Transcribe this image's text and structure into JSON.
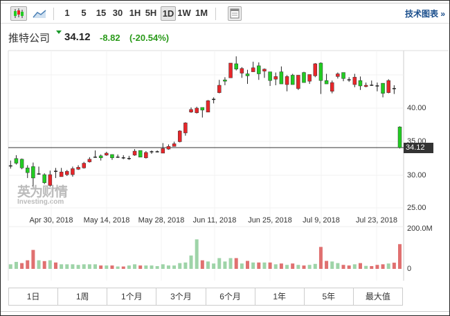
{
  "toolbar": {
    "intervals": [
      "1",
      "5",
      "15",
      "30",
      "1H",
      "5H",
      "1D",
      "1W",
      "1M"
    ],
    "active_interval": "1D",
    "tech_chart_link": "技术图表 »"
  },
  "quote": {
    "name": "推特公司",
    "price": "34.12",
    "change": "-8.82",
    "change_pct": "(-20.54%)",
    "direction": "down"
  },
  "watermark": {
    "cn": "英为财情",
    "en": "Investing.com"
  },
  "axis": {
    "price_labels": [
      "40.00",
      "35.00",
      "30.00",
      "25.00"
    ],
    "volume_labels": [
      "200.0M",
      "0"
    ],
    "dates": [
      "Apr 30, 2018",
      "May 14, 2018",
      "May 28, 2018",
      "Jun 11, 2018",
      "Jun 25, 2018",
      "Jul 9, 2018",
      "Jul 23, 2018"
    ],
    "current_price_tag": "34.12"
  },
  "colors": {
    "candle_up": "#e8262a",
    "candle_down": "#22cc22",
    "vol_red": "#e07070",
    "vol_green": "#9ed4a8"
  },
  "ranges": [
    "1日",
    "1周",
    "1个月",
    "3个月",
    "6个月",
    "1年",
    "5年",
    "最大值"
  ],
  "chart_data": {
    "type": "candlestick",
    "ylim": [
      24,
      49
    ],
    "candles_ohlc": [
      [
        31.4,
        32.2,
        31.0,
        31.4
      ],
      [
        32.5,
        33.0,
        31.6,
        31.8
      ],
      [
        32.4,
        32.5,
        30.9,
        31.1
      ],
      [
        31.1,
        31.5,
        29.6,
        30.4
      ],
      [
        31.3,
        31.9,
        28.4,
        29.6
      ],
      [
        30.2,
        31.3,
        30.1,
        30.2
      ],
      [
        30.1,
        30.3,
        28.7,
        28.9
      ],
      [
        28.5,
        30.7,
        28.3,
        30.1
      ],
      [
        30.6,
        31.1,
        29.6,
        30.6
      ],
      [
        29.8,
        31.1,
        29.8,
        30.5
      ],
      [
        30.1,
        30.8,
        29.9,
        30.6
      ],
      [
        30.1,
        31.3,
        29.8,
        31.0
      ],
      [
        30.9,
        31.5,
        30.8,
        31.2
      ],
      [
        31.1,
        32.0,
        31.0,
        31.8
      ],
      [
        32.0,
        32.7,
        31.9,
        32.4
      ],
      [
        32.7,
        33.7,
        32.6,
        32.7
      ],
      [
        32.9,
        33.1,
        32.2,
        32.6
      ],
      [
        33.0,
        33.5,
        32.9,
        33.3
      ],
      [
        33.1,
        33.1,
        32.3,
        32.6
      ],
      [
        32.7,
        33.1,
        32.6,
        32.7
      ],
      [
        32.6,
        33.0,
        32.4,
        32.6
      ],
      [
        32.5,
        32.9,
        32.3,
        32.5
      ],
      [
        33.0,
        33.9,
        32.9,
        33.6
      ],
      [
        33.7,
        33.7,
        32.7,
        32.7
      ],
      [
        32.6,
        33.6,
        32.5,
        33.4
      ],
      [
        33.5,
        33.7,
        33.2,
        33.5
      ],
      [
        33.5,
        33.7,
        33.4,
        33.5
      ],
      [
        33.3,
        34.8,
        33.3,
        34.0
      ],
      [
        33.9,
        34.6,
        33.8,
        34.3
      ],
      [
        34.3,
        35.0,
        34.3,
        34.7
      ],
      [
        35.0,
        36.7,
        34.9,
        36.6
      ],
      [
        36.3,
        37.9,
        35.9,
        37.8
      ],
      [
        39.4,
        40.1,
        39.3,
        39.8
      ],
      [
        39.3,
        40.2,
        39.2,
        40.0
      ],
      [
        40.1,
        40.1,
        38.6,
        39.7
      ],
      [
        39.4,
        41.2,
        39.4,
        41.1
      ],
      [
        41.3,
        41.6,
        40.7,
        41.3
      ],
      [
        42.3,
        44.2,
        42.2,
        43.4
      ],
      [
        44.2,
        44.6,
        43.4,
        44.0
      ],
      [
        44.5,
        46.7,
        44.5,
        46.7
      ],
      [
        46.6,
        47.7,
        45.6,
        45.8
      ],
      [
        45.2,
        46.1,
        44.5,
        45.9
      ],
      [
        45.1,
        45.7,
        43.6,
        44.8
      ],
      [
        45.4,
        46.9,
        45.4,
        46.0
      ],
      [
        46.3,
        46.8,
        44.2,
        45.1
      ],
      [
        45.5,
        45.9,
        44.5,
        45.8
      ],
      [
        45.4,
        45.4,
        43.3,
        44.1
      ],
      [
        44.3,
        45.3,
        43.4,
        44.7
      ],
      [
        45.4,
        46.2,
        43.6,
        43.6
      ],
      [
        43.5,
        44.9,
        42.5,
        44.7
      ],
      [
        44.9,
        45.1,
        43.5,
        43.5
      ],
      [
        42.9,
        44.9,
        42.7,
        44.9
      ],
      [
        45.3,
        45.4,
        43.8,
        43.8
      ],
      [
        44.0,
        45.0,
        43.6,
        45.0
      ],
      [
        44.8,
        46.7,
        44.6,
        46.6
      ],
      [
        46.7,
        46.8,
        42.1,
        44.1
      ],
      [
        44.1,
        45.1,
        43.6,
        43.6
      ],
      [
        42.5,
        44.1,
        42.2,
        43.8
      ],
      [
        44.7,
        45.3,
        44.4,
        45.1
      ],
      [
        45.3,
        45.3,
        44.0,
        44.4
      ],
      [
        44.2,
        44.6,
        43.9,
        44.2
      ],
      [
        43.5,
        45.1,
        43.1,
        44.6
      ],
      [
        44.1,
        44.7,
        42.7,
        43.3
      ],
      [
        43.2,
        43.8,
        43.1,
        43.4
      ],
      [
        43.4,
        44.1,
        43.3,
        43.4
      ],
      [
        43.3,
        43.8,
        42.5,
        43.3
      ],
      [
        43.7,
        43.7,
        41.6,
        42.2
      ],
      [
        42.3,
        44.3,
        42.2,
        44.1
      ],
      [
        42.9,
        43.4,
        42.1,
        42.9
      ],
      [
        37.2,
        37.3,
        34.0,
        34.12
      ]
    ],
    "volume_millions": [
      23,
      35,
      29,
      43,
      95,
      43,
      39,
      43,
      32,
      23,
      23,
      23,
      20,
      23,
      23,
      23,
      17,
      17,
      17,
      12,
      12,
      17,
      23,
      17,
      17,
      17,
      14,
      23,
      17,
      17,
      29,
      32,
      67,
      148,
      43,
      37,
      27,
      54,
      37,
      54,
      54,
      27,
      40,
      32,
      32,
      32,
      32,
      23,
      27,
      20,
      27,
      20,
      17,
      20,
      25,
      110,
      40,
      37,
      29,
      20,
      17,
      23,
      29,
      15,
      14,
      20,
      23,
      27,
      31,
      124
    ],
    "volume_colors": [
      "g",
      "g",
      "r",
      "r",
      "r",
      "g",
      "r",
      "g",
      "r",
      "g",
      "g",
      "g",
      "g",
      "g",
      "g",
      "g",
      "r",
      "g",
      "r",
      "g",
      "r",
      "g",
      "g",
      "r",
      "g",
      "g",
      "g",
      "g",
      "g",
      "g",
      "g",
      "g",
      "g",
      "g",
      "r",
      "g",
      "g",
      "g",
      "g",
      "g",
      "r",
      "g",
      "r",
      "g",
      "r",
      "g",
      "r",
      "g",
      "r",
      "g",
      "r",
      "g",
      "r",
      "g",
      "g",
      "r",
      "r",
      "g",
      "g",
      "r",
      "r",
      "g",
      "r",
      "g",
      "r",
      "r",
      "r",
      "g",
      "r",
      "r"
    ],
    "volume_max": 200
  }
}
